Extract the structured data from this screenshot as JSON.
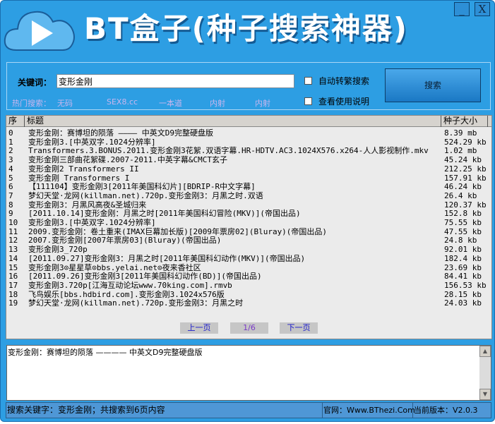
{
  "app": {
    "title": "BT盒子(种子搜索神器)",
    "minimize": "_",
    "close": "X"
  },
  "search": {
    "keyword_label": "关键词：",
    "keyword_value": "变形金刚",
    "auto_traditional": "自动转繁搜索",
    "view_help": "查看使用说明",
    "button": "搜索",
    "hot_label": "热门搜索：",
    "hot_items": [
      "无码",
      "SEX8.cc",
      "一本道",
      "内射",
      "内射"
    ]
  },
  "list": {
    "headers": [
      "序",
      "标题",
      "种子大小"
    ],
    "rows": [
      [
        "0",
        "变形金刚：赛博坦的陨落 ———— 中英文D9完整硬盘版",
        "8.39 mb"
      ],
      [
        "1",
        "变形金刚3.[中英双字.1024分辨率]",
        "524.29 kb"
      ],
      [
        "2",
        "Transformers.3.BONUS.2011.变形金刚3花絮.双语字幕.HR-HDTV.AC3.1024X576.x264-人人影视制作.mkv",
        "1.02 mb"
      ],
      [
        "3",
        "变形金刚三部曲花絮碟.2007-2011.中英字幕&CMCT玄子",
        "45.24 kb"
      ],
      [
        "4",
        "变形金刚2 Transformers II",
        "212.25 kb"
      ],
      [
        "5",
        "变形金刚 Transformers I",
        "157.91 kb"
      ],
      [
        "6",
        "【111104】变形金刚3[2011年美国科幻片][BDRIP-R中文字幕]",
        "46.24 kb"
      ],
      [
        "7",
        "梦幻天堂·龙网(killman.net).720p.变形金刚3：月黑之时.双语",
        "26.4 kb"
      ],
      [
        "8",
        "变形金刚3：月黑风高夜&圣城归来",
        "120.37 kb"
      ],
      [
        "9",
        "[2011.10.14]变形金刚：月黑之时[2011年美国科幻冒险(MKV)](帝国出品)",
        "152.8 kb"
      ],
      [
        "10",
        "变形金刚3.[中英双字.1024分辨率]",
        "75.55 kb"
      ],
      [
        "11",
        "2009.变形金刚：卷土重来(IMAX巨幕加长版)[2009年票房02](Bluray)(帝国出品)",
        "47.55 kb"
      ],
      [
        "12",
        "2007.变形金刚[2007年票房03](Bluray)(帝国出品)",
        "24.8 kb"
      ],
      [
        "13",
        "变形金刚3_720p",
        "92.01 kb"
      ],
      [
        "14",
        "[2011.09.27]变形金刚3：月黑之时[2011年美国科幻动作(MKV)](帝国出品)",
        "182.4 kb"
      ],
      [
        "15",
        "变形金刚3⊙星星草⊙bbs.yelai.net⊙夜来香社区",
        "23.69 kb"
      ],
      [
        "16",
        "[2011.09.26]变形金刚3[2011年美国科幻动作(BD)](帝国出品)",
        "84.41 kb"
      ],
      [
        "17",
        "变形金刚3.720p[江海互动论坛www.70king.com].rmvb",
        "156.53 kb"
      ],
      [
        "18",
        "飞鸟娱乐[bbs.hdbird.com].变形金刚3.1024x576版",
        "28.15 kb"
      ],
      [
        "19",
        "梦幻天堂·龙网(killman.net).720p.变形金刚3：月黑之时",
        "24.03 kb"
      ]
    ]
  },
  "pagination": {
    "prev": "上一页",
    "page": "1/6",
    "next": "下一页"
  },
  "detail": {
    "text": "变形金刚：赛博坦的陨落 ———— 中英文D9完整硬盘版"
  },
  "status": {
    "summary": "搜索关键字：变形金刚；共搜索到6页内容",
    "site": "官网：Www.BThezi.Com",
    "version": "当前版本：V2.0.3"
  },
  "colors": {
    "window": "#2d9ee3",
    "list_bg": "#ebebeb",
    "hot_text": "#c9b6ee",
    "status_bg": "#4f97d6"
  }
}
